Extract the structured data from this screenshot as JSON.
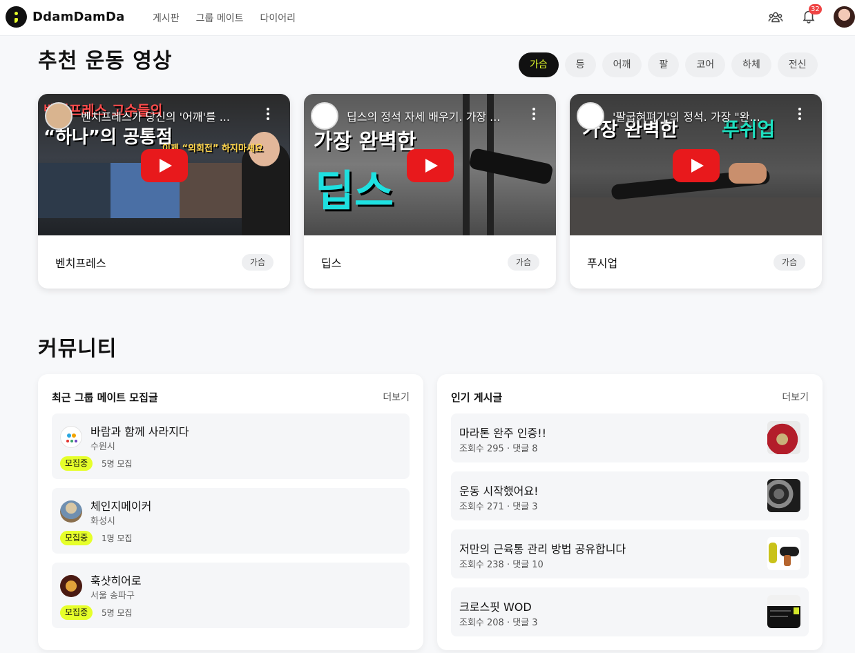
{
  "header": {
    "brand": "DdamDamDa",
    "nav": [
      "게시판",
      "그룹 메이트",
      "다이어리"
    ],
    "notification_count": "32"
  },
  "videos_section": {
    "title": "추천 운동 영상",
    "filters": [
      "가슴",
      "등",
      "어깨",
      "팔",
      "코어",
      "하체",
      "전신"
    ],
    "active_filter": "가슴",
    "cards": [
      {
        "video_title": "벤치프레스가 당신의 '어깨'를 ...",
        "thumb_text_1": "벤치프레스 고수들의",
        "thumb_text_2": "“하나”의 공통점",
        "thumb_text_3": "이제 “외회전” 하지마세요",
        "name": "벤치프레스",
        "tag": "가슴"
      },
      {
        "video_title": "딥스의 정석 자세 배우기. 가장 ...",
        "thumb_text_1": "가장 완벽한",
        "thumb_text_2": "딥스",
        "name": "딥스",
        "tag": "가슴"
      },
      {
        "video_title": "'팔굽혀펴기'의 정석. 가장 \"완...",
        "thumb_text_1": "가장 완벽한",
        "thumb_text_2": "푸쉬업",
        "name": "푸시업",
        "tag": "가슴"
      }
    ]
  },
  "community": {
    "title": "커뮤니티",
    "groups_panel": {
      "title": "최근 그룹 메이트 모집글",
      "more": "더보기",
      "items": [
        {
          "name": "바람과 함께 사라지다",
          "location": "수원시",
          "status": "모집중",
          "count": "5명 모집"
        },
        {
          "name": "체인지메이커",
          "location": "화성시",
          "status": "모집중",
          "count": "1명 모집"
        },
        {
          "name": "훅샷히어로",
          "location": "서울 송파구",
          "status": "모집중",
          "count": "5명 모집"
        }
      ]
    },
    "posts_panel": {
      "title": "인기 게시글",
      "more": "더보기",
      "items": [
        {
          "title": "마라톤 완주 인증!!",
          "meta": "조회수 295 · 댓글 8"
        },
        {
          "title": "운동 시작했어요!",
          "meta": "조회수 271 · 댓글 3"
        },
        {
          "title": "저만의 근육통 관리 방법 공유합니다",
          "meta": "조회수 238 · 댓글 10"
        },
        {
          "title": "크로스핏 WOD",
          "meta": "조회수 208 · 댓글 3"
        }
      ]
    }
  },
  "colors": {
    "accent": "#e6ff2a",
    "dark": "#111111",
    "badge_red": "#ef4444",
    "youtube_red": "#e8191c"
  }
}
